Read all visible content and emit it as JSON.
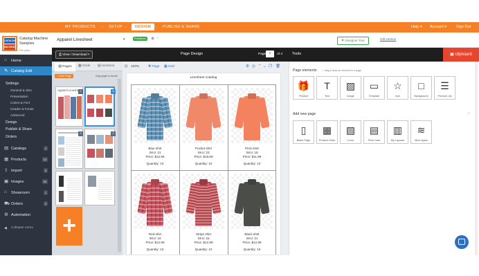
{
  "topnav": {
    "crumbs": [
      "MY PRODUCTS",
      "SETUP",
      "DESIGN",
      "PUBLISH & SHARE"
    ],
    "right": [
      "Help",
      "Account",
      "Sign Out"
    ]
  },
  "brand": {
    "logo_top": "CATALOG",
    "logo_bottom": "MACHINE",
    "name": "Catalog Machine Samples",
    "plan": "Pro plan"
  },
  "sidebar": {
    "items": [
      {
        "icon": "⌂",
        "label": "Home",
        "badge": ""
      },
      {
        "icon": "✎",
        "label": "Catalog Edit",
        "badge": ""
      },
      {
        "icon": "▤",
        "label": "Catalogs",
        "badge": "4"
      },
      {
        "icon": "▦",
        "label": "Products",
        "badge": "18"
      },
      {
        "icon": "⇪",
        "label": "Import",
        "badge": "6"
      },
      {
        "icon": "▣",
        "label": "Images",
        "badge": "56"
      },
      {
        "icon": "⌂",
        "label": "Showroom",
        "badge": "1"
      },
      {
        "icon": "⛟",
        "label": "Orders",
        "badge": "0"
      },
      {
        "icon": "⚙",
        "label": "Automation",
        "badge": ""
      },
      {
        "icon": "◀",
        "label": "Collapse menu",
        "badge": ""
      }
    ],
    "settings_label": "Settings",
    "settings_sub": [
      "General & Size",
      "Presentation",
      "Colors & Font",
      "Header & Footer",
      "Advanced"
    ],
    "more_sub": [
      "Design",
      "Publish & Share",
      "Orders"
    ]
  },
  "header": {
    "doc_title": "Apparel Linesheet",
    "status_badge": "Published",
    "tour_button": "Designer Tour",
    "old_version": "Old version"
  },
  "toolbar": {
    "view_download": "View / Download",
    "title": "Page Design",
    "page_label": "Page",
    "page_value": "1",
    "of_label": "of 4",
    "zoom": "100%",
    "page_btn": "Page",
    "grid_btn": "Grid"
  },
  "tools": {
    "title": "Tools",
    "clipboard": "clipboard",
    "page_elements_title": "Page elements",
    "page_elements_hint": "drag & drop an element to a page",
    "elements": [
      {
        "icon": "gift-icon",
        "glyph": "🎁",
        "label": "Product"
      },
      {
        "icon": "text-icon",
        "glyph": "T",
        "label": "Text"
      },
      {
        "icon": "image-icon",
        "glyph": "▨",
        "label": "Image"
      },
      {
        "icon": "template-icon",
        "glyph": "▭",
        "label": "Template"
      },
      {
        "icon": "star-icon",
        "glyph": "☆",
        "label": "Icon"
      },
      {
        "icon": "background-icon",
        "glyph": "□",
        "label": "Background"
      },
      {
        "icon": "list-icon",
        "glyph": "☰",
        "label": "Product List"
      }
    ],
    "add_page_title": "Add new page",
    "pages": [
      {
        "icon": "blank-page-icon",
        "glyph": "▯",
        "label": "Blank Page"
      },
      {
        "icon": "product-grid-icon",
        "glyph": "▦",
        "label": "Product Grids"
      },
      {
        "icon": "cover-icon",
        "glyph": "▧",
        "label": "Cover"
      },
      {
        "icon": "price-list-icon",
        "glyph": "▤",
        "label": "Price Lists"
      },
      {
        "icon": "my-layouts-icon",
        "glyph": "▥",
        "label": "My Layouts"
      },
      {
        "icon": "layers-icon",
        "glyph": "≋",
        "label": "More types"
      }
    ]
  },
  "pages_panel": {
    "tabs": [
      "Pages",
      "Grids",
      "Sections"
    ],
    "new_page": "+ New Page",
    "hint": "Drag pages to reorder",
    "thumb_title": "Apparel Linesheet",
    "page_numbers": [
      "1",
      "2",
      "3",
      "4"
    ],
    "add_symbol": "+"
  },
  "canvas": {
    "page_title": "Linesheet Catalog",
    "products": [
      {
        "name": "Blue shirt",
        "sku": "SKU: 21",
        "price": "Price: $12.95",
        "qty": "Quantity:    10",
        "color": "#5f93b8",
        "pattern": "plaid"
      },
      {
        "name": "Pocket shirt",
        "sku": "SKU: 23",
        "price": "Price: $15.59",
        "qty": "Quantity:    10",
        "color": "#f0886a",
        "pattern": "solid"
      },
      {
        "name": "Picki shirt",
        "sku": "SKU: 18",
        "price": "Price: $11.99",
        "qty": "Quantity:    10",
        "color": "#f5825e",
        "pattern": "solid"
      },
      {
        "name": "Red shirt",
        "sku": "SKU: 16",
        "price": "Price: $12.99",
        "qty": "Quantity:    10",
        "color": "#c9505d",
        "pattern": "plaid"
      },
      {
        "name": "Stripe shirt",
        "sku": "SKU: 2a",
        "price": "Price: $12.99",
        "qty": "Quantity:    10",
        "color": "#b8434a",
        "pattern": "stripe"
      },
      {
        "name": "Black shirt",
        "sku": "SKU: 21",
        "price": "Price: $12.99",
        "qty": "Quantity:    10",
        "color": "#4a4d48",
        "pattern": "solid"
      }
    ]
  },
  "colors": {
    "accent": "#f58025",
    "sidebar": "#2d3440",
    "active_nav": "#2f87c8",
    "clipboard": "#e8452f",
    "chat": "#2f6fbf"
  }
}
